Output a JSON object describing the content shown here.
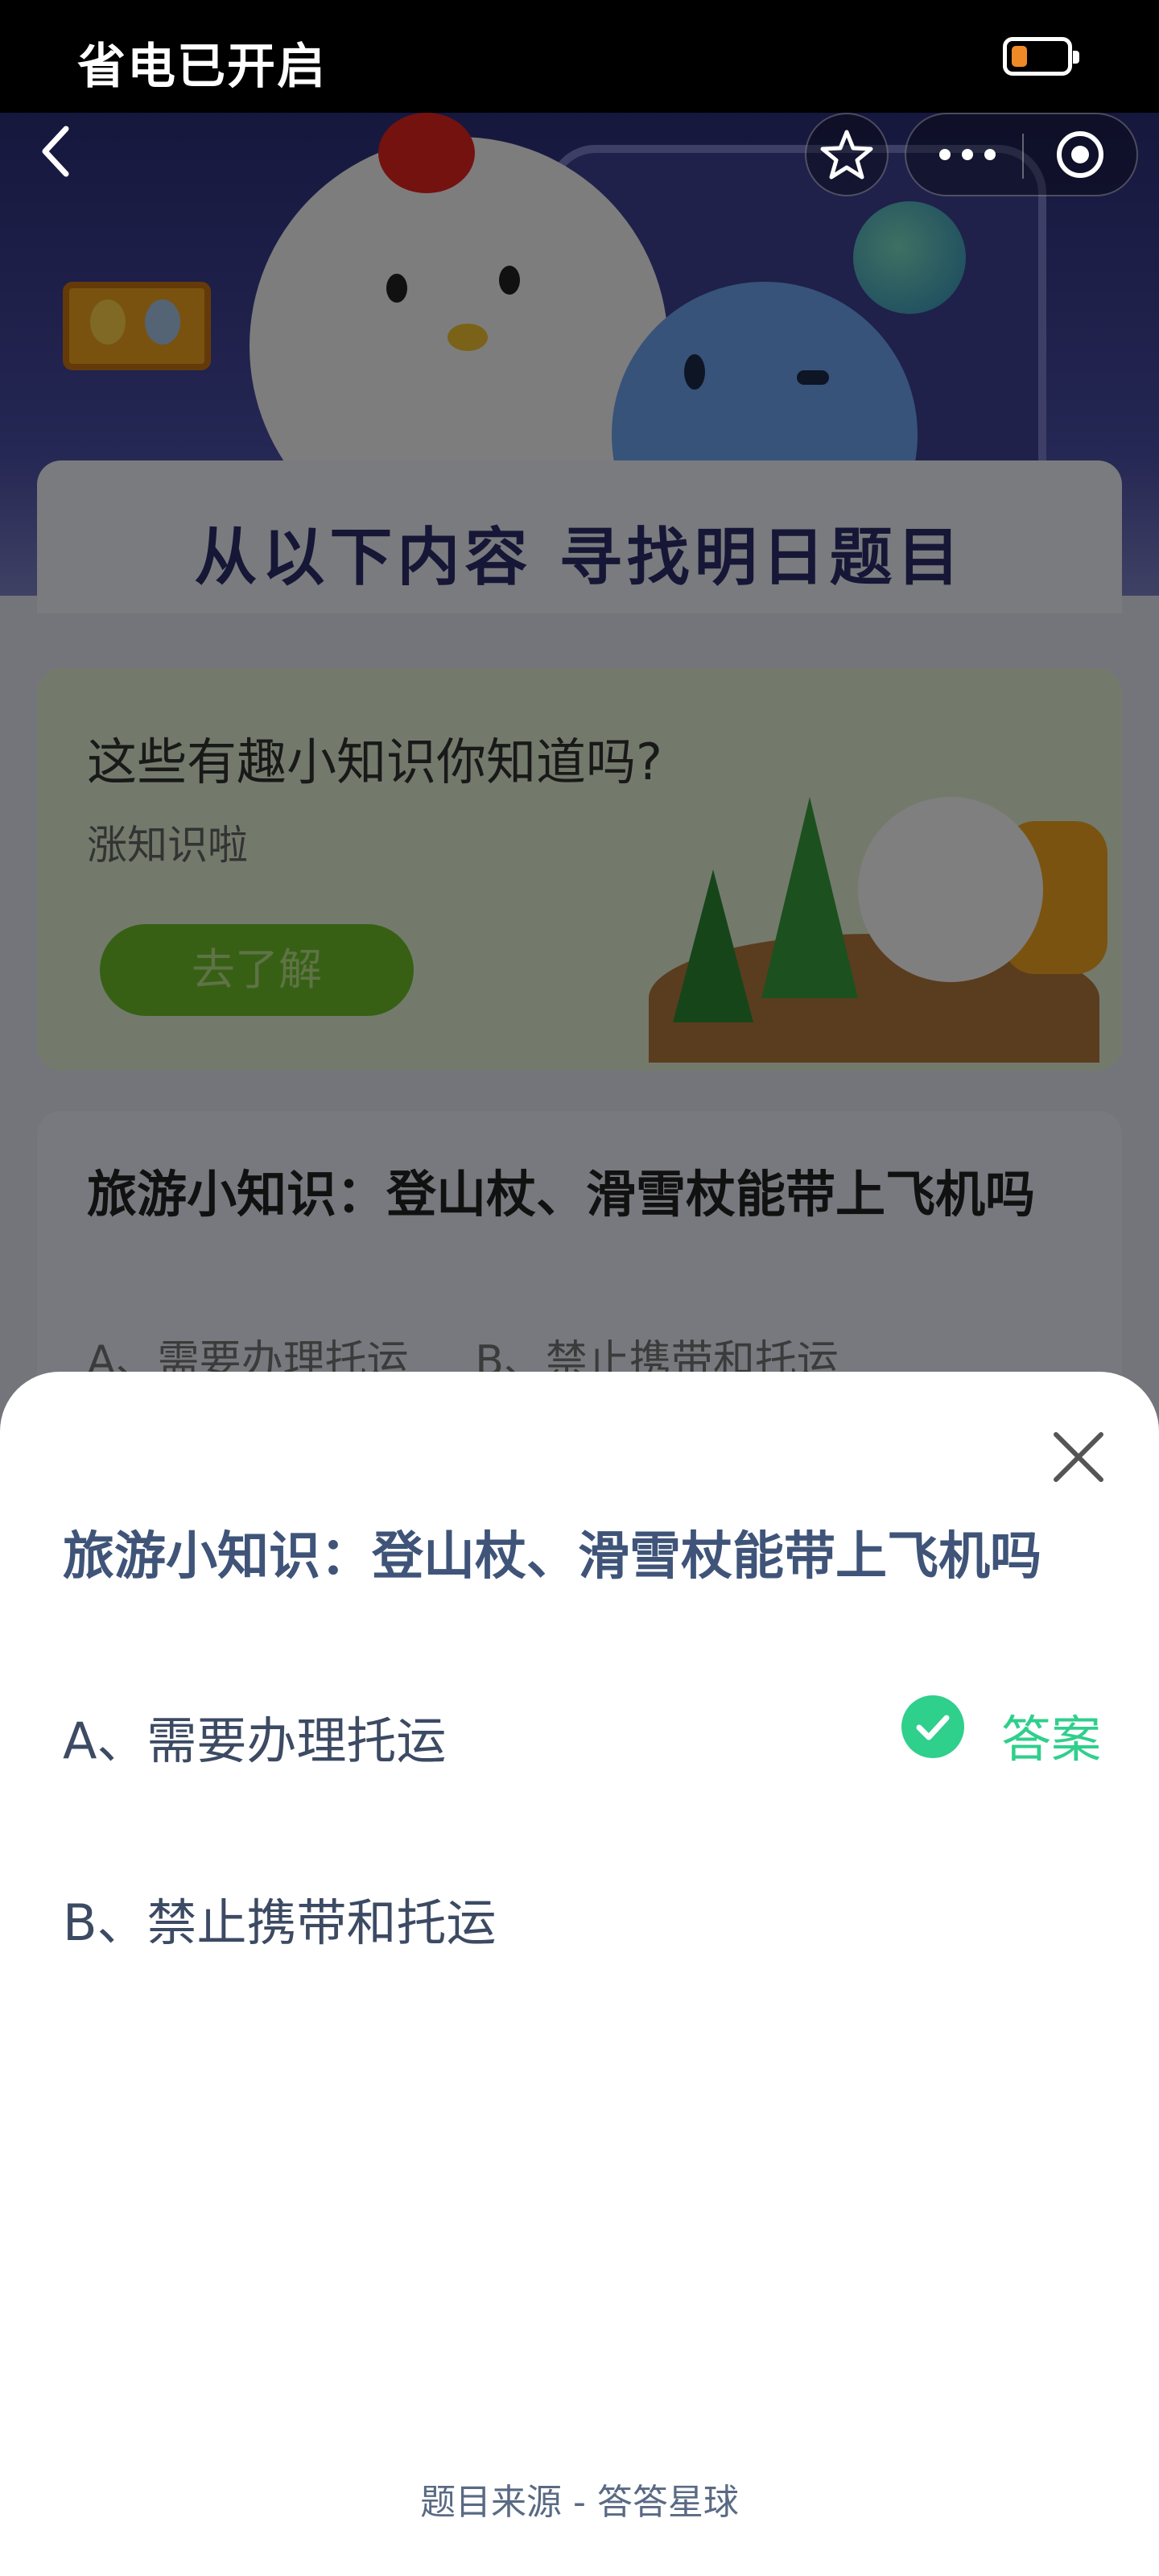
{
  "status_bar": {
    "text": "省电已开启",
    "battery_level": 0.3,
    "battery_color": "#f08a26"
  },
  "nav": {
    "back_icon": "chevron-left-icon",
    "favorite_icon": "star-outline-icon",
    "more_icon": "more-dots-icon",
    "close_icon": "target-close-icon"
  },
  "page": {
    "hero_title": "从以下内容 寻找明日题目",
    "knowledge_card": {
      "title": "这些有趣小知识你知道吗?",
      "subtitle": "涨知识啦",
      "button_label": "去了解"
    },
    "question_card": {
      "title": "旅游小知识：登山杖、滑雪杖能带上飞机吗",
      "options_preview": "A、需要办理托运     B、禁止携带和托运"
    }
  },
  "sheet": {
    "title": "旅游小知识：登山杖、滑雪杖能带上飞机吗",
    "options": [
      {
        "label": "A、需要办理托运",
        "is_answer": true
      },
      {
        "label": "B、禁止携带和托运",
        "is_answer": false
      }
    ],
    "answer_label": "答案",
    "answer_color": "#2fcf8c",
    "footer": "题目来源 - 答答星球"
  }
}
